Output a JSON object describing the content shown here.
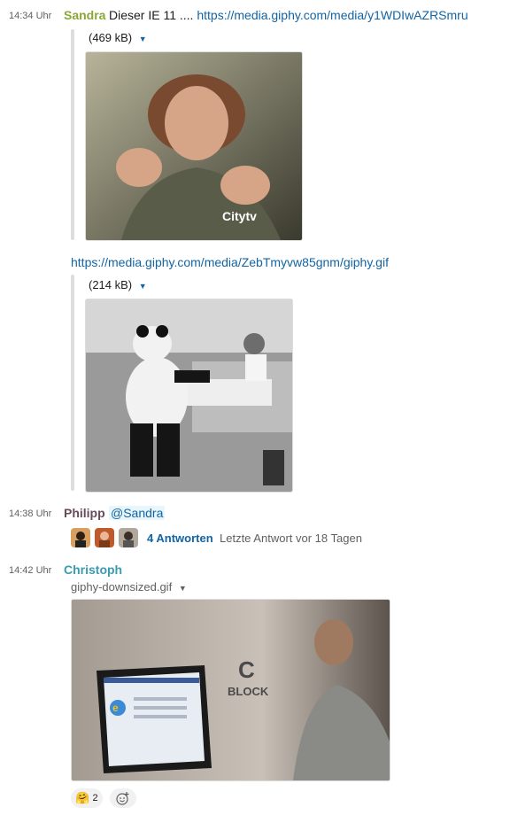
{
  "messages": [
    {
      "time": "14:34 Uhr",
      "author": "Sandra",
      "author_color": "#8ba735",
      "text": "Dieser IE 11 ....",
      "link": "https://media.giphy.com/media/y1WDIwAZRSmru",
      "attachment1_size": "(469 kB)",
      "link2": "https://media.giphy.com/media/ZebTmyvw85gnm/giphy.gif",
      "attachment2_size": "(214 kB)",
      "image1_text": "Citytv"
    },
    {
      "time": "14:38 Uhr",
      "author": "Philipp",
      "author_color": "#674b5a",
      "mention": "@Sandra",
      "replies": "4 Antworten",
      "last_reply": "Letzte Antwort vor 18 Tagen"
    },
    {
      "time": "14:42 Uhr",
      "author": "Christoph",
      "author_color": "#3a9bb1",
      "filename": "giphy-downsized.gif",
      "image_wall_text1": "C",
      "image_wall_text2": "BLOCK",
      "reaction_count": "2"
    }
  ],
  "colors": {
    "link": "#1264a3",
    "time": "#616061",
    "mention_bg": "#e8f5fa"
  },
  "icons": {
    "caret": "caret-down-icon",
    "add_reaction": "add-reaction-icon",
    "reaction": "hugging-face-emoji"
  }
}
